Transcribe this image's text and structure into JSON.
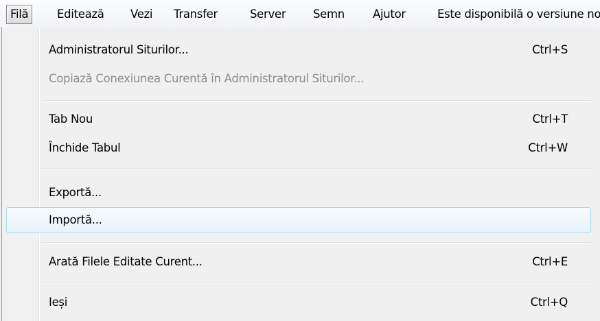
{
  "menubar": {
    "items": [
      {
        "label": "Filă",
        "active": true
      },
      {
        "label": "Editează"
      },
      {
        "label": "Vezi"
      },
      {
        "label": "Transfer"
      },
      {
        "label": "Server"
      },
      {
        "label": "Semn"
      },
      {
        "label": "Ajutor"
      },
      {
        "label": "Este disponibilă o versiune nouă!"
      }
    ]
  },
  "file_menu": {
    "items": [
      {
        "label": "Administratorul Siturilor...",
        "shortcut": "Ctrl+S"
      },
      {
        "label": "Copiază Conexiunea Curentă în Administratorul Siturilor...",
        "shortcut": "",
        "disabled": true
      },
      {
        "label": "Tab Nou",
        "shortcut": "Ctrl+T"
      },
      {
        "label": "Închide Tabul",
        "shortcut": "Ctrl+W"
      },
      {
        "label": "Exportă...",
        "shortcut": ""
      },
      {
        "label": "Importă...",
        "shortcut": "",
        "highlighted": true
      },
      {
        "label": "Arată Filele Editate Curent...",
        "shortcut": "Ctrl+E"
      },
      {
        "label": "Ieși",
        "shortcut": "Ctrl+Q"
      }
    ]
  }
}
